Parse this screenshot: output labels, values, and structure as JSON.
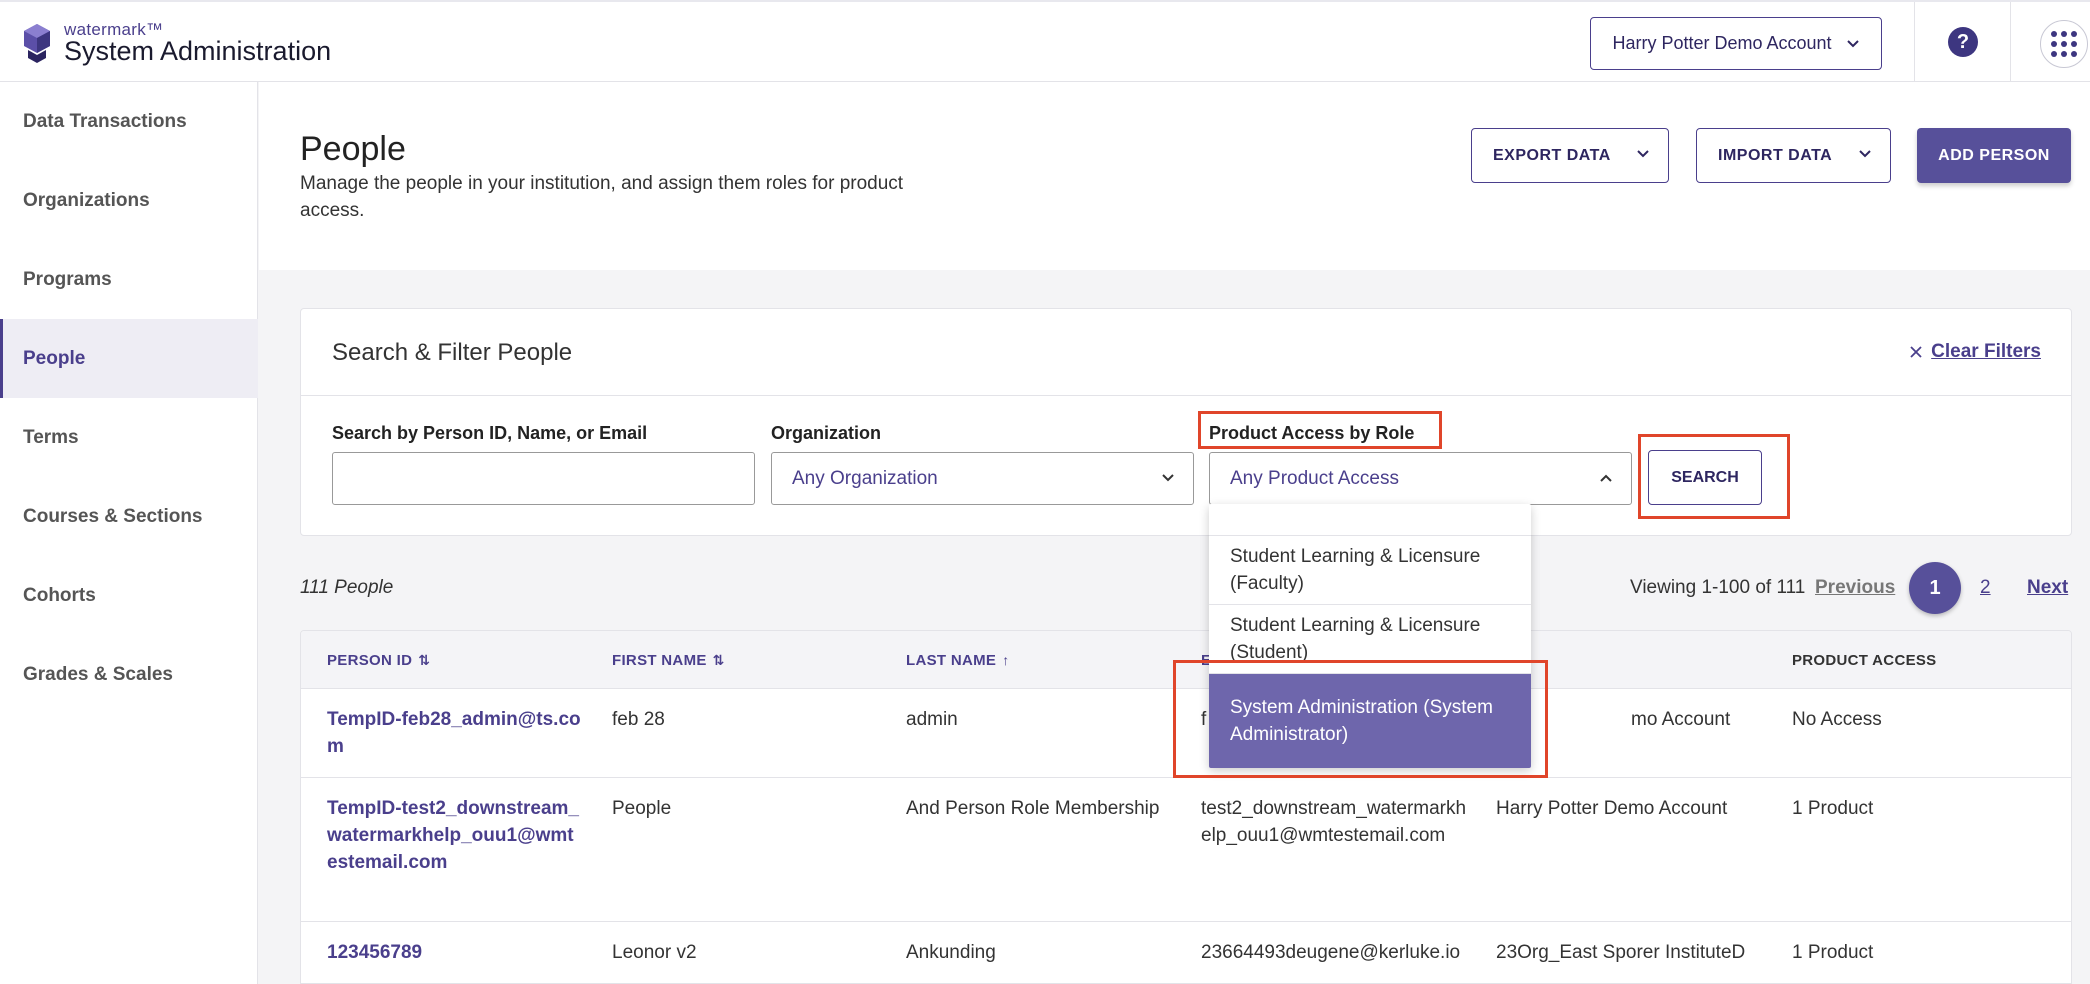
{
  "header": {
    "brand_small": "watermark™",
    "brand_title": "System Administration",
    "account": "Harry Potter Demo Account",
    "help": "?"
  },
  "sidebar": {
    "items": [
      {
        "label": "Data Transactions",
        "active": false
      },
      {
        "label": "Organizations",
        "active": false
      },
      {
        "label": "Programs",
        "active": false
      },
      {
        "label": "People",
        "active": true
      },
      {
        "label": "Terms",
        "active": false
      },
      {
        "label": "Courses & Sections",
        "active": false
      },
      {
        "label": "Cohorts",
        "active": false
      },
      {
        "label": "Grades & Scales",
        "active": false
      }
    ]
  },
  "page": {
    "title": "People",
    "description": "Manage the people in your institution, and assign them roles for product access.",
    "export_label": "EXPORT DATA",
    "import_label": "IMPORT DATA",
    "add_label": "ADD PERSON"
  },
  "filters": {
    "title": "Search & Filter People",
    "clear_label": "Clear Filters",
    "search_label": "Search by Person ID, Name, or Email",
    "search_value": "",
    "org_label": "Organization",
    "org_value": "Any Organization",
    "role_label": "Product Access by Role",
    "role_value": "Any Product Access",
    "search_button": "SEARCH"
  },
  "dropdown": {
    "options": [
      "Student Learning & Licensure (Faculty)",
      "Student Learning & Licensure (Student)",
      "System Administration (System Administrator)"
    ],
    "selected_index": 2
  },
  "results": {
    "count": "111 People",
    "viewing": "Viewing 1-100 of 111",
    "previous": "Previous",
    "current_page": "1",
    "page_2": "2",
    "next": "Next"
  },
  "table": {
    "headers": [
      "PERSON ID",
      "FIRST NAME",
      "LAST NAME",
      "E",
      "",
      "PRODUCT ACCESS"
    ],
    "rows": [
      {
        "id": "TempID-feb28_admin@ts.com",
        "first": "feb 28",
        "last": "admin",
        "email": "f",
        "org": "mo Account",
        "access": "No Access"
      },
      {
        "id": "TempID-test2_downstream_watermarkhelp_ouu1@wmtestemail.com",
        "first": "People",
        "last": "And Person Role Membership",
        "email": "test2_downstream_watermarkhelp_ouu1@wmtestemail.com",
        "org": "Harry Potter Demo Account",
        "access": "1 Product"
      },
      {
        "id": "123456789",
        "first": "Leonor v2",
        "last": "Ankunding",
        "email": "23664493deugene@kerluke.io",
        "org": "23Org_East Sporer InstituteD",
        "access": "1 Product"
      }
    ]
  },
  "colors": {
    "brand": "#4a3f8c",
    "primary_button": "#57509a",
    "selected_option": "#6e66ac",
    "highlight": "#e0452a"
  }
}
